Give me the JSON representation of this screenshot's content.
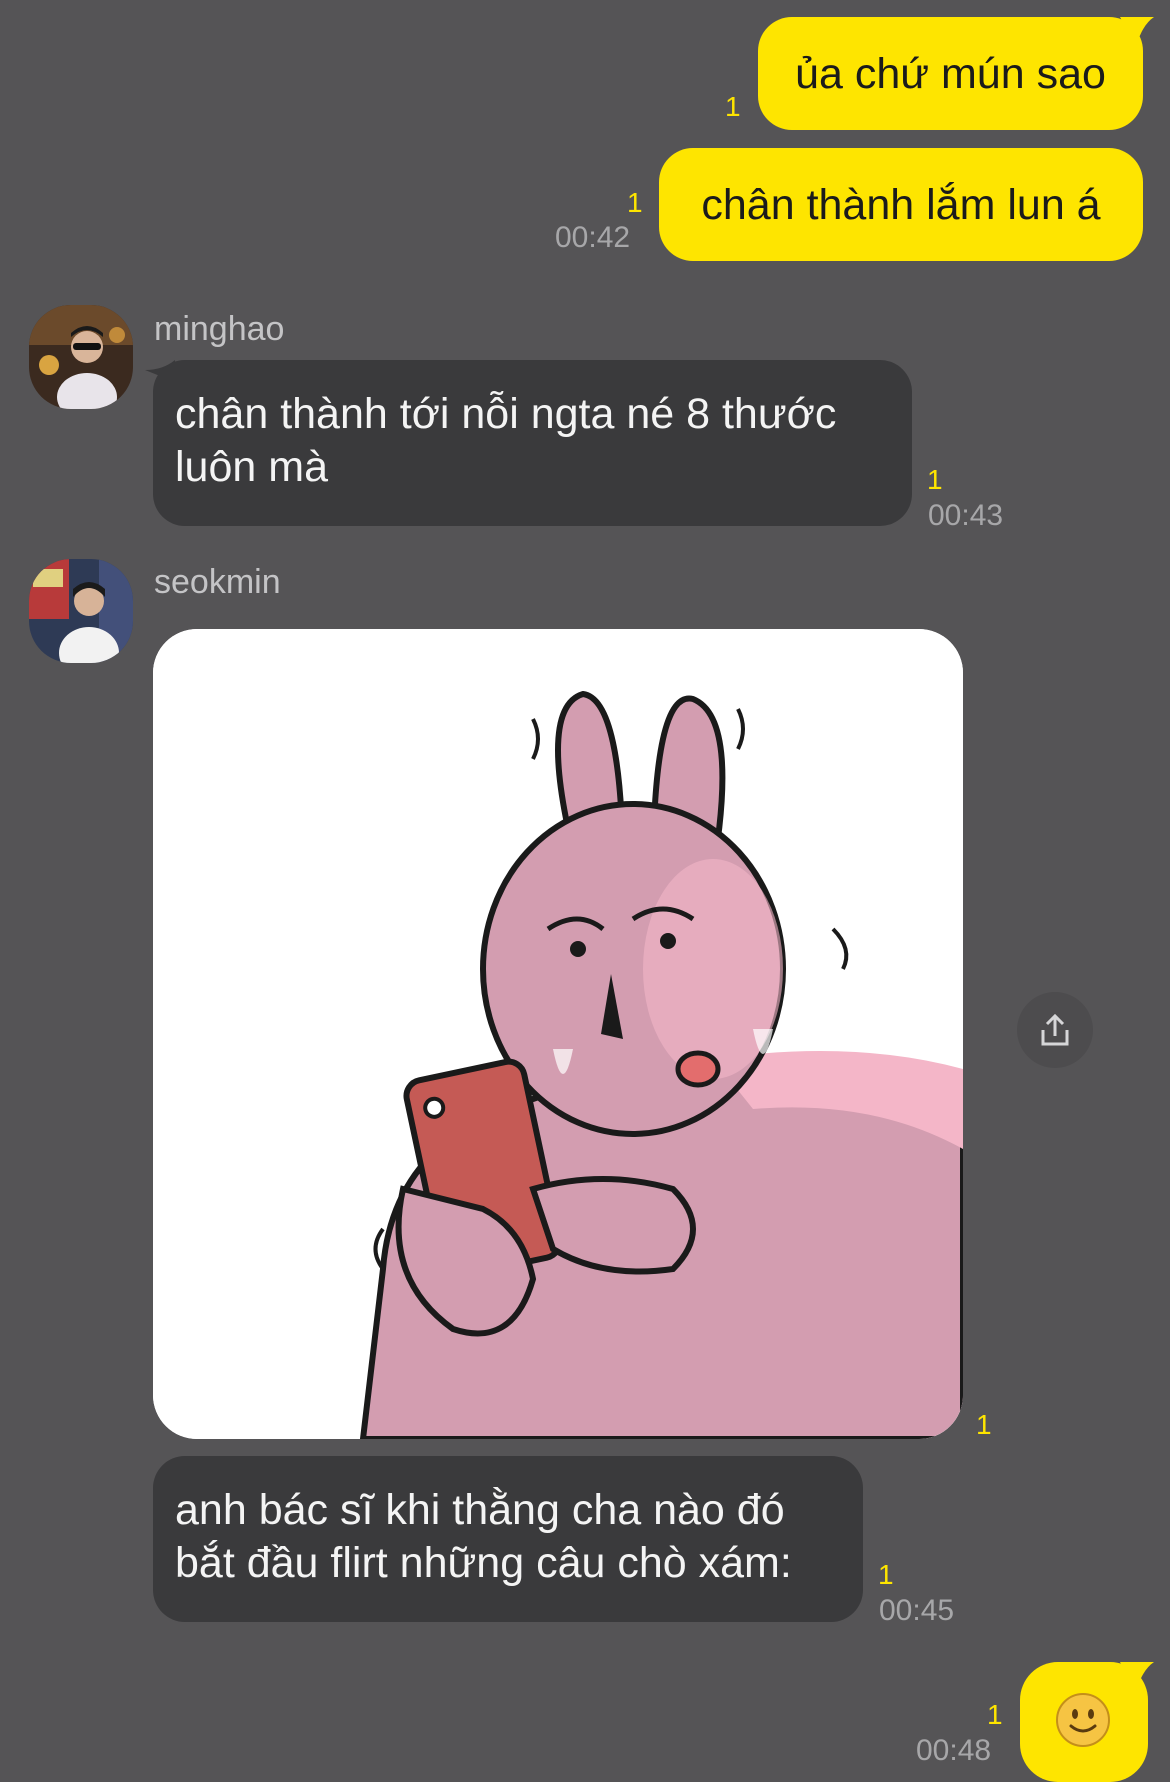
{
  "messages": {
    "m1": {
      "text": "ủa chứ mún sao",
      "unread": "1"
    },
    "m2": {
      "text": "chân thành lắm lun á",
      "unread": "1",
      "time": "00:42"
    },
    "m3": {
      "sender": "minghao",
      "text": "chân thành tới nỗi ngta né 8 thước luôn mà",
      "unread": "1",
      "time": "00:43"
    },
    "m4": {
      "sender": "seokmin",
      "photo_alt": "pink rabbit sticker staring at red phone",
      "unread": "1"
    },
    "m5": {
      "text": "anh bác sĩ khi thằng cha nào đó bắt đầu flirt những câu chò xám:",
      "unread": "1",
      "time": "00:45"
    },
    "m6": {
      "emoji": "slightly-smiling-face",
      "unread": "1",
      "time": "00:48"
    }
  },
  "colors": {
    "background": "#555456",
    "outgoing_bubble": "#fee500",
    "incoming_bubble": "#3a3a3c",
    "unread_count": "#fee500",
    "timestamp": "#a7a7a9"
  },
  "icons": [
    "share-icon",
    "slightly-smiling-face-emoji"
  ]
}
